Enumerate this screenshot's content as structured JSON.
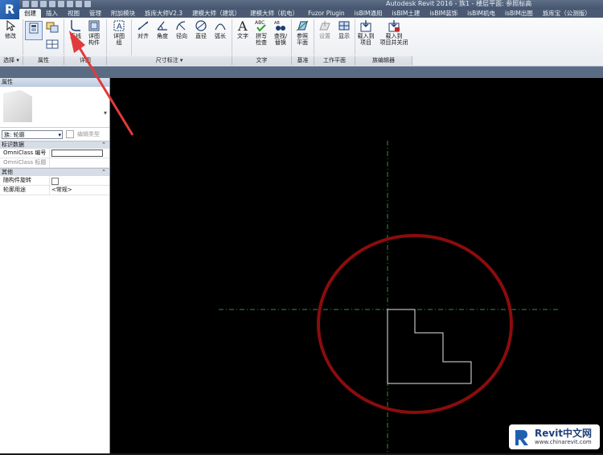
{
  "window": {
    "app_title": "Autodesk Revit 2016 -   族1 - 楼层平面: 参照标高",
    "logo": "R"
  },
  "tabs": [
    "创建",
    "插入",
    "视图",
    "管理",
    "附加模块",
    "族库大师V2.3",
    "建模大师（建筑）",
    "建模大师（机电）",
    "Fuzor Plugin",
    "isBIM通用",
    "isBIM土建",
    "isBIM装饰",
    "isBIM机电",
    "isBIM出图",
    "族库宝（公测版）"
  ],
  "ribbon": {
    "modify": "修改",
    "line": "直线",
    "detail_component_1": "详图",
    "detail_component_2": "构件",
    "detail_group_1": "详图",
    "detail_group_2": "组",
    "align": "对齐",
    "angle": "角度",
    "radius": "径向",
    "diameter": "直径",
    "arc_length": "弧长",
    "text": "文字",
    "spell_1": "拼写",
    "spell_2": "检查",
    "find_1": "查找/",
    "find_2": "替换",
    "ref_plane_1": "参照",
    "ref_plane_2": "平面",
    "set": "设置",
    "show": "显示",
    "load_1": "载入到",
    "load_2": "项目",
    "load_close_1": "载入到",
    "load_close_2": "项目并关闭",
    "panels": {
      "select": "选择 ▾",
      "properties": "属性",
      "detail": "详图",
      "dimension": "尺寸标注 ▾",
      "text": "文字",
      "datum": "基准",
      "work_plane": "工作平面",
      "family_editor": "族编辑器"
    }
  },
  "properties": {
    "header": "属性",
    "type_selector": "族: 轮廓",
    "edit_type": "编辑类型",
    "groups": [
      {
        "name": "标识数据",
        "rows": [
          {
            "key": "OmniClass 编号",
            "value": ""
          },
          {
            "key": "OmniClass 标题",
            "value": ""
          }
        ]
      },
      {
        "name": "其他",
        "rows": [
          {
            "key": "随构件旋转",
            "value": ""
          },
          {
            "key": "轮廓用途",
            "value": "<常规>"
          }
        ]
      }
    ]
  },
  "watermark": {
    "brand": "Revit中文网",
    "url": "www.chinarevit.com"
  },
  "colors": {
    "canvas_bg": "#000000",
    "ref_plane": "#2f8f3a",
    "profile": "#e6e6e6",
    "circle": "#8b0c0c",
    "arrow": "#e23a3a"
  }
}
